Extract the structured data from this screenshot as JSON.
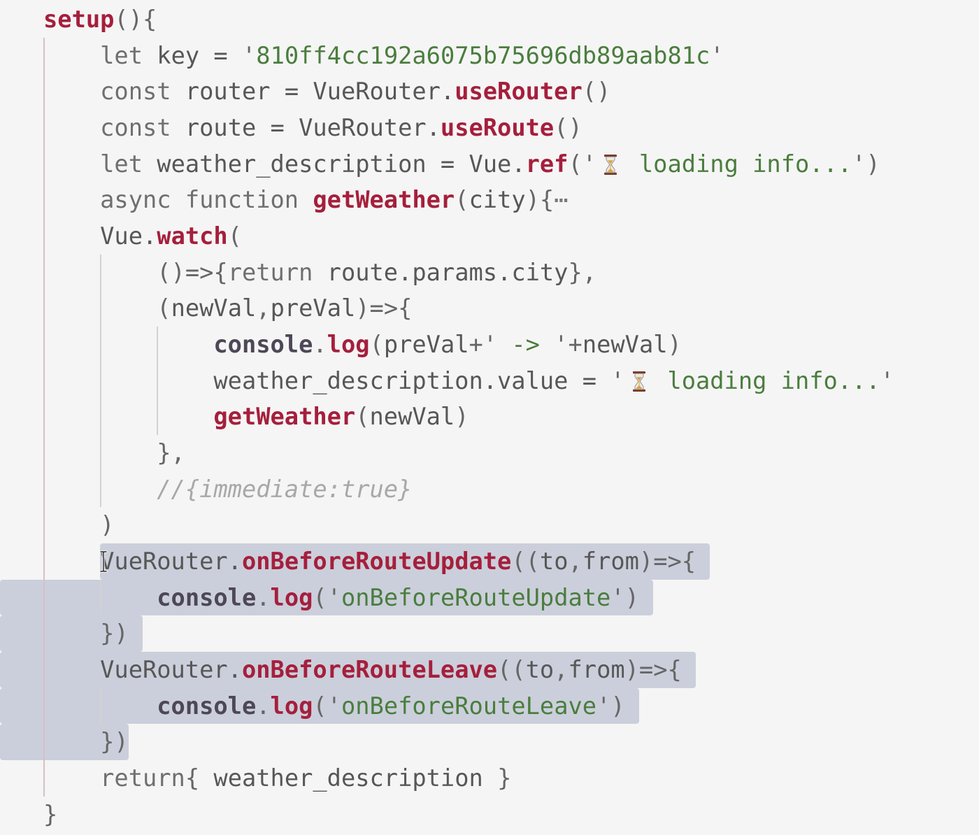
{
  "editor": {
    "lines": [
      {
        "tokens": [
          {
            "k": "fn",
            "t": "setup"
          },
          {
            "k": "p",
            "t": "(){"
          }
        ]
      },
      {
        "tokens": [
          {
            "k": "ws",
            "t": "    "
          },
          {
            "k": "kw",
            "t": "let"
          },
          {
            "k": "id",
            "t": " key = "
          },
          {
            "k": "p",
            "t": "'"
          },
          {
            "k": "str",
            "t": "810ff4cc192a6075b75696db89aab81c"
          },
          {
            "k": "p",
            "t": "'"
          }
        ]
      },
      {
        "tokens": [
          {
            "k": "ws",
            "t": "    "
          },
          {
            "k": "kw",
            "t": "const"
          },
          {
            "k": "id",
            "t": " router = VueRouter."
          },
          {
            "k": "fn",
            "t": "useRouter"
          },
          {
            "k": "p",
            "t": "()"
          }
        ]
      },
      {
        "tokens": [
          {
            "k": "ws",
            "t": "    "
          },
          {
            "k": "kw",
            "t": "const"
          },
          {
            "k": "id",
            "t": " route = VueRouter."
          },
          {
            "k": "fn",
            "t": "useRoute"
          },
          {
            "k": "p",
            "t": "()"
          }
        ]
      },
      {
        "tokens": [
          {
            "k": "ws",
            "t": "    "
          },
          {
            "k": "kw",
            "t": "let"
          },
          {
            "k": "id",
            "t": " weather_description = Vue."
          },
          {
            "k": "fn",
            "t": "ref"
          },
          {
            "k": "p",
            "t": "('"
          },
          {
            "k": "icon",
            "icon": "hourglass-icon"
          },
          {
            "k": "str",
            "t": " loading info..."
          },
          {
            "k": "p",
            "t": "')"
          }
        ]
      },
      {
        "tokens": [
          {
            "k": "ws",
            "t": "    "
          },
          {
            "k": "kw",
            "t": "async function "
          },
          {
            "k": "fn",
            "t": "getWeather"
          },
          {
            "k": "p",
            "t": "("
          },
          {
            "k": "id",
            "t": "city"
          },
          {
            "k": "p",
            "t": "){"
          },
          {
            "k": "fold",
            "t": "⋯"
          }
        ]
      },
      {
        "tokens": [
          {
            "k": "ws",
            "t": "    "
          },
          {
            "k": "id",
            "t": "Vue."
          },
          {
            "k": "fn",
            "t": "watch"
          },
          {
            "k": "p",
            "t": "("
          }
        ]
      },
      {
        "tokens": [
          {
            "k": "ws",
            "t": "        "
          },
          {
            "k": "p",
            "t": "()=>{"
          },
          {
            "k": "kw",
            "t": "return"
          },
          {
            "k": "id",
            "t": " route.params.city"
          },
          {
            "k": "p",
            "t": "},"
          }
        ]
      },
      {
        "tokens": [
          {
            "k": "ws",
            "t": "        "
          },
          {
            "k": "p",
            "t": "("
          },
          {
            "k": "id",
            "t": "newVal"
          },
          {
            "k": "p",
            "t": ","
          },
          {
            "k": "id",
            "t": "preVal"
          },
          {
            "k": "p",
            "t": ")=>{"
          }
        ]
      },
      {
        "tokens": [
          {
            "k": "ws",
            "t": "            "
          },
          {
            "k": "con",
            "t": "console"
          },
          {
            "k": "p",
            "t": "."
          },
          {
            "k": "fn",
            "t": "log"
          },
          {
            "k": "p",
            "t": "("
          },
          {
            "k": "id",
            "t": "preVal"
          },
          {
            "k": "p",
            "t": "+'"
          },
          {
            "k": "str",
            "t": " -> "
          },
          {
            "k": "p",
            "t": "'+"
          },
          {
            "k": "id",
            "t": "newVal"
          },
          {
            "k": "p",
            "t": ")"
          }
        ]
      },
      {
        "tokens": [
          {
            "k": "ws",
            "t": "            "
          },
          {
            "k": "id",
            "t": "weather_description.value = "
          },
          {
            "k": "p",
            "t": "'"
          },
          {
            "k": "icon",
            "icon": "hourglass-icon"
          },
          {
            "k": "str",
            "t": " loading info..."
          },
          {
            "k": "p",
            "t": "'"
          }
        ]
      },
      {
        "tokens": [
          {
            "k": "ws",
            "t": "            "
          },
          {
            "k": "fn",
            "t": "getWeather"
          },
          {
            "k": "p",
            "t": "("
          },
          {
            "k": "id",
            "t": "newVal"
          },
          {
            "k": "p",
            "t": ")"
          }
        ]
      },
      {
        "tokens": [
          {
            "k": "ws",
            "t": "        "
          },
          {
            "k": "p",
            "t": "},"
          }
        ]
      },
      {
        "tokens": [
          {
            "k": "ws",
            "t": "        "
          },
          {
            "k": "cm",
            "t": "//{immediate:true}"
          }
        ]
      },
      {
        "tokens": [
          {
            "k": "ws",
            "t": "    "
          },
          {
            "k": "p",
            "t": ")"
          }
        ]
      },
      {
        "tokens": [
          {
            "k": "ws",
            "t": "    "
          },
          {
            "k": "id",
            "t": "VueRouter."
          },
          {
            "k": "fn",
            "t": "onBeforeRouteUpdate"
          },
          {
            "k": "p",
            "t": "(("
          },
          {
            "k": "id",
            "t": "to"
          },
          {
            "k": "p",
            "t": ","
          },
          {
            "k": "id",
            "t": "from"
          },
          {
            "k": "p",
            "t": ")=>{"
          }
        ]
      },
      {
        "tokens": [
          {
            "k": "ws",
            "t": "        "
          },
          {
            "k": "con",
            "t": "console"
          },
          {
            "k": "p",
            "t": "."
          },
          {
            "k": "fn",
            "t": "log"
          },
          {
            "k": "p",
            "t": "('"
          },
          {
            "k": "str",
            "t": "onBeforeRouteUpdate"
          },
          {
            "k": "p",
            "t": "')"
          }
        ]
      },
      {
        "tokens": [
          {
            "k": "ws",
            "t": "    "
          },
          {
            "k": "p",
            "t": "})"
          }
        ]
      },
      {
        "tokens": [
          {
            "k": "ws",
            "t": "    "
          },
          {
            "k": "id",
            "t": "VueRouter."
          },
          {
            "k": "fn",
            "t": "onBeforeRouteLeave"
          },
          {
            "k": "p",
            "t": "(("
          },
          {
            "k": "id",
            "t": "to"
          },
          {
            "k": "p",
            "t": ","
          },
          {
            "k": "id",
            "t": "from"
          },
          {
            "k": "p",
            "t": ")=>{"
          }
        ]
      },
      {
        "tokens": [
          {
            "k": "ws",
            "t": "        "
          },
          {
            "k": "con",
            "t": "console"
          },
          {
            "k": "p",
            "t": "."
          },
          {
            "k": "fn",
            "t": "log"
          },
          {
            "k": "p",
            "t": "('"
          },
          {
            "k": "str",
            "t": "onBeforeRouteLeave"
          },
          {
            "k": "p",
            "t": "')"
          }
        ]
      },
      {
        "tokens": [
          {
            "k": "ws",
            "t": "    "
          },
          {
            "k": "p",
            "t": "})"
          }
        ]
      },
      {
        "tokens": [
          {
            "k": "ws",
            "t": "    "
          },
          {
            "k": "kw",
            "t": "return"
          },
          {
            "k": "p",
            "t": "{ "
          },
          {
            "k": "id",
            "t": "weather_description"
          },
          {
            "k": "p",
            "t": " }"
          }
        ]
      },
      {
        "tokens": [
          {
            "k": "p",
            "t": "}"
          }
        ]
      }
    ],
    "selection": {
      "start": {
        "line": 16,
        "col": 4
      },
      "end": {
        "line": 21,
        "col": 6
      }
    },
    "mouse_pointer": "text-cursor-icon"
  },
  "theme": {
    "background": "#f5f5f5",
    "selection": "#cbcfdb",
    "indent_guide": "#d2d2d2",
    "indent_guide_active": "#d6c0c7",
    "keyword": "#6f6f6f",
    "identifier": "#575757",
    "punctuation": "#666666",
    "function": "#a51f3c",
    "console": "#4d4757",
    "string": "#4a7d3d",
    "comment": "#a8a8a8",
    "fold": "#777777"
  }
}
